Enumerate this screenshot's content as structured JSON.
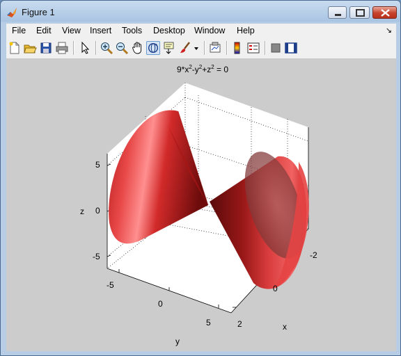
{
  "window": {
    "title": "Figure 1"
  },
  "menu": [
    "File",
    "Edit",
    "View",
    "Insert",
    "Tools",
    "Desktop",
    "Window",
    "Help"
  ],
  "menu_dock_glyph": "↘",
  "toolbar": {
    "buttons": [
      "new-figure-icon",
      "open-file-icon",
      "save-icon",
      "print-icon",
      "edit-plot-icon",
      "zoom-in-icon",
      "zoom-out-icon",
      "pan-icon",
      "rotate-3d-icon",
      "data-cursor-icon",
      "brush-icon",
      "brush-dropdown-icon",
      "link-plot-icon",
      "insert-colorbar-icon",
      "insert-legend-icon",
      "hide-plot-tools-icon",
      "show-plot-tools-icon"
    ],
    "pressed": "rotate-3d-icon"
  },
  "plot": {
    "title_parts": {
      "a": "9*x",
      "sup1": "2",
      "b": "-y",
      "sup2": "2",
      "c": "+z",
      "sup3": "2",
      "d": " = 0"
    },
    "z_label": "z",
    "y_label": "y",
    "x_label": "x",
    "z_ticks": [
      "5",
      "0",
      "-5"
    ],
    "y_ticks": [
      "-5",
      "0",
      "5"
    ],
    "x_ticks": [
      "-2",
      "0",
      "2"
    ],
    "colors": {
      "background": "#cccccc",
      "surface": "#e8484a",
      "surface_dark": "#7a1212"
    }
  }
}
